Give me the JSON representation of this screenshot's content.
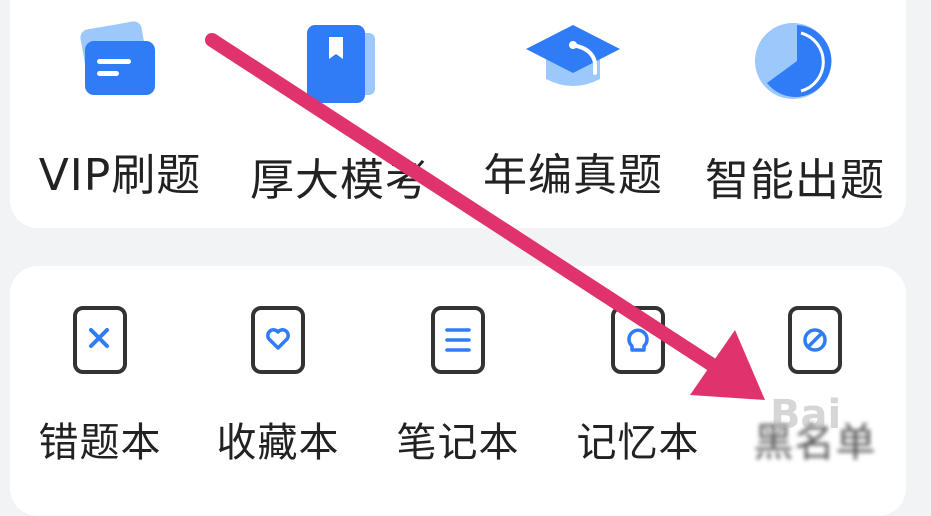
{
  "top_row": [
    {
      "label": "VIP刷题",
      "icon": "vip-card-icon"
    },
    {
      "label": "厚大模考",
      "icon": "bookmark-book-icon"
    },
    {
      "label": "年编真题",
      "icon": "graduation-cap-icon"
    },
    {
      "label": "智能出题",
      "icon": "pie-chart-icon"
    }
  ],
  "bottom_row": [
    {
      "label": "错题本",
      "icon": "x-notebook-icon"
    },
    {
      "label": "收藏本",
      "icon": "heart-notebook-icon"
    },
    {
      "label": "笔记本",
      "icon": "lines-notebook-icon"
    },
    {
      "label": "记忆本",
      "icon": "bulb-notebook-icon"
    },
    {
      "label": "黑名单",
      "icon": "ban-notebook-icon"
    }
  ],
  "colors": {
    "accent_blue": "#2f7cf6",
    "light_blue": "#8fc1fb",
    "outline": "#333333",
    "arrow": "#e0336e"
  },
  "watermark": "Bai"
}
